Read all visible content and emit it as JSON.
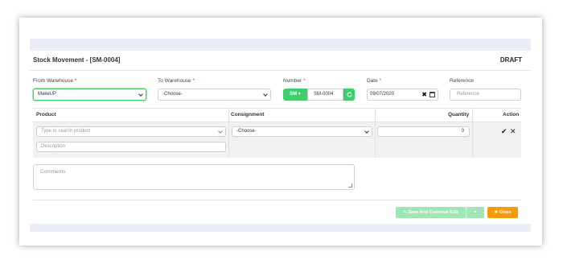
{
  "header": {
    "title": "Stock Movement - [SM-0004]",
    "status": "DRAFT"
  },
  "form": {
    "from_warehouse": {
      "label": "From Warehouse",
      "required": "*",
      "value": "MakeUP"
    },
    "to_warehouse": {
      "label": "To Warehouse",
      "required": "*",
      "value": "-Choose-"
    },
    "number": {
      "label": "Number",
      "required": "*",
      "prefix": "SM ▾",
      "value": "SM-0004",
      "refresh_icon": "refresh-icon"
    },
    "date": {
      "label": "Date",
      "required": "*",
      "value": "09/07/2020",
      "clear_glyph": "✖"
    },
    "reference": {
      "label": "Reference",
      "placeholder": "Reference"
    }
  },
  "table": {
    "headers": {
      "product": "Product",
      "consignment": "Consignment",
      "quantity": "Quantity",
      "action": "Action"
    },
    "row": {
      "product_placeholder": "Type to search product",
      "description_placeholder": "Description",
      "consignment_value": "-Choose-",
      "quantity": "0",
      "confirm_glyph": "✔",
      "remove_glyph": "✕"
    }
  },
  "comments": {
    "placeholder": "Comments"
  },
  "footer": {
    "save_label": "✎ Save And Continue Edit",
    "dropdown_label": "▾",
    "close_label": "✖ Close"
  },
  "colors": {
    "accent": "#3ecf6a",
    "close": "#f59b0c",
    "required": "#e53935"
  }
}
